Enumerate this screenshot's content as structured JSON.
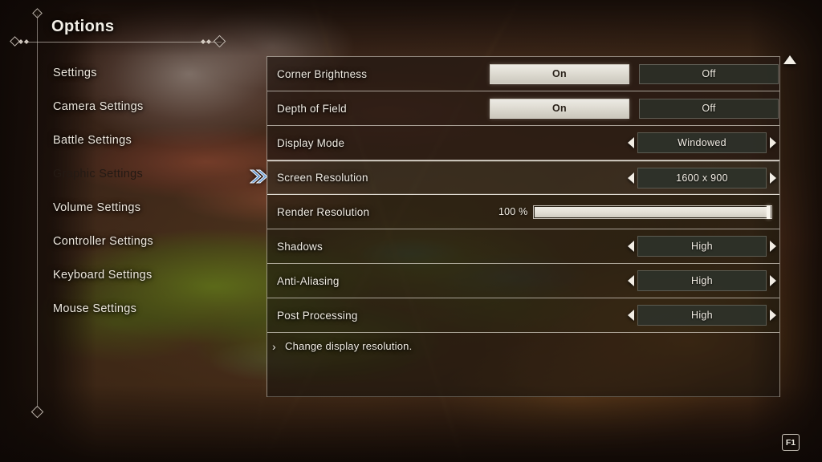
{
  "header": {
    "title": "Options"
  },
  "sidebar": {
    "items": [
      {
        "label": "Settings",
        "selected": false
      },
      {
        "label": "Camera Settings",
        "selected": false
      },
      {
        "label": "Battle Settings",
        "selected": false
      },
      {
        "label": "Graphic Settings",
        "selected": true
      },
      {
        "label": "Volume Settings",
        "selected": false
      },
      {
        "label": "Controller Settings",
        "selected": false
      },
      {
        "label": "Keyboard Settings",
        "selected": false
      },
      {
        "label": "Mouse Settings",
        "selected": false
      }
    ]
  },
  "panel": {
    "rows": [
      {
        "label": "Corner Brightness",
        "control": "toggle",
        "on_label": "On",
        "off_label": "Off",
        "value": "On",
        "selected": false
      },
      {
        "label": "Depth of Field",
        "control": "toggle",
        "on_label": "On",
        "off_label": "Off",
        "value": "On",
        "selected": false
      },
      {
        "label": "Display Mode",
        "control": "stepper",
        "value": "Windowed",
        "selected": false
      },
      {
        "label": "Screen Resolution",
        "control": "stepper",
        "value": "1600 x 900",
        "selected": true
      },
      {
        "label": "Render Resolution",
        "control": "slider",
        "value": "100 %",
        "percent": 100,
        "selected": false
      },
      {
        "label": "Shadows",
        "control": "stepper",
        "value": "High",
        "selected": false
      },
      {
        "label": "Anti-Aliasing",
        "control": "stepper",
        "value": "High",
        "selected": false
      },
      {
        "label": "Post Processing",
        "control": "stepper",
        "value": "High",
        "selected": false
      }
    ],
    "description": "Change display resolution.",
    "description_chevron": "›"
  },
  "indicators": {
    "scroll_up_icon": "scroll-up-arrow-icon",
    "selection_cursor_icon": "double-chevron-right-icon",
    "key_hint": "F1"
  },
  "colors": {
    "selected_fill": "#f4efe6",
    "panel_border": "#e2dcd2",
    "text_light": "#f0ebe2",
    "text_dark": "#241a14",
    "cursor_blue": "#5b8fc9"
  }
}
